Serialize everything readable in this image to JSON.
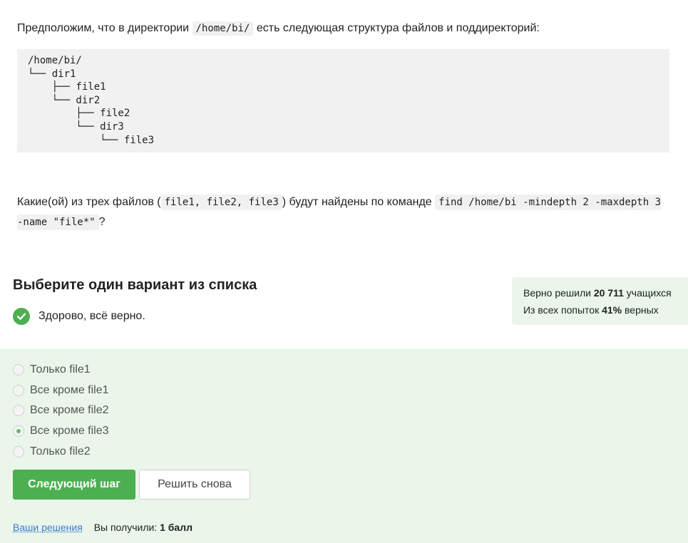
{
  "intro": {
    "text_before": "Предположим, что в директории ",
    "dir_code": "/home/bi/",
    "text_after": " есть следующая структура файлов и поддиректорий:"
  },
  "tree": [
    "/home/bi/",
    "└── dir1",
    "    ├── file1",
    "    └── dir2",
    "        ├── file2",
    "        └── dir3",
    "            └── file3"
  ],
  "question": {
    "text_before": "Какие(ой) из трех файлов (",
    "files_code": "file1, file2, file3",
    "text_middle": ") будут найдены по команде ",
    "command_code": "find /home/bi -mindepth 2 -maxdepth 3 -name \"file*\"",
    "text_after": "?"
  },
  "choose_title": "Выберите один вариант из списка",
  "status": {
    "icon": "check-circle-icon",
    "text": "Здорово, всё верно."
  },
  "stats": {
    "solved_prefix": "Верно решили ",
    "solved_count": "20 711",
    "solved_suffix": " учащихся",
    "attempts_prefix": "Из всех попыток ",
    "attempts_percent": "41%",
    "attempts_suffix": " верных"
  },
  "options": [
    {
      "label": "Только file1",
      "checked": false
    },
    {
      "label": "Все кроме file1",
      "checked": false
    },
    {
      "label": "Все кроме file2",
      "checked": false
    },
    {
      "label": "Все кроме file3",
      "checked": true
    },
    {
      "label": "Только file2",
      "checked": false
    }
  ],
  "buttons": {
    "next": "Следующий шаг",
    "retry": "Решить снова"
  },
  "footer": {
    "solutions_link": "Ваши решения",
    "score_prefix": "Вы получили: ",
    "score_value": "1 балл"
  },
  "colors": {
    "accent_green": "#4caf50",
    "answer_background": "#e9f6e9",
    "link_blue": "#3c7bd4"
  }
}
